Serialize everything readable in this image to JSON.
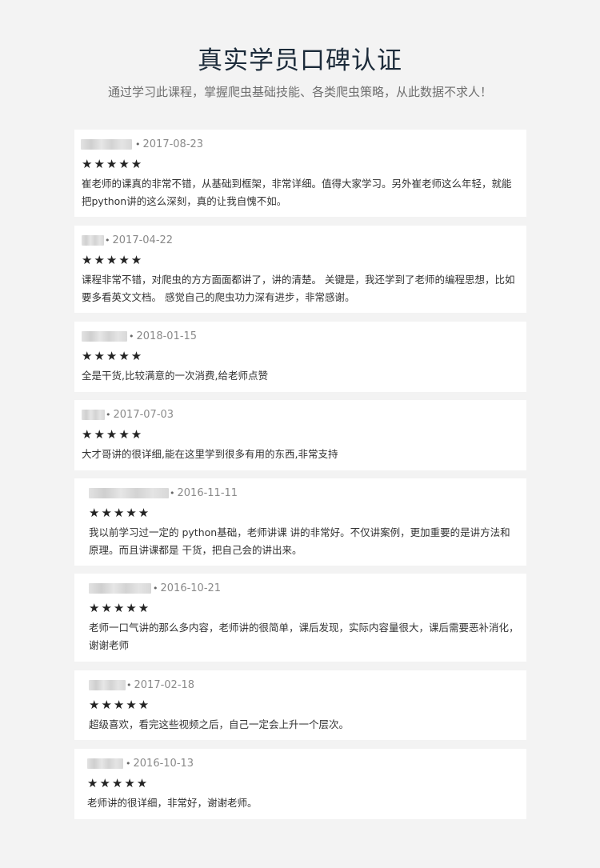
{
  "header": {
    "title": "真实学员口碑认证",
    "subtitle": "通过学习此课程，掌握爬虫基础技能、各类爬虫策略，从此数据不求人！"
  },
  "reviews": [
    {
      "date": "2017-08-23",
      "stars": "★★★★★",
      "text": "崔老师的课真的非常不错，从基础到框架，非常详细。值得大家学习。另外崔老师这么年轻，就能把python讲的这么深刻，真的让我自愧不如。"
    },
    {
      "date": "2017-04-22",
      "stars": "★★★★★",
      "text": "课程非常不错，对爬虫的方方面面都讲了，讲的清楚。 关键是，我还学到了老师的编程思想，比如要多看英文文档。 感觉自己的爬虫功力深有进步，非常感谢。"
    },
    {
      "date": "2018-01-15",
      "stars": "★★★★★",
      "text": "全是干货,比较满意的一次消费,给老师点赞"
    },
    {
      "date": "2017-07-03",
      "stars": "★★★★★",
      "text": "大才哥讲的很详细,能在这里学到很多有用的东西,非常支持"
    },
    {
      "date": "2016-11-11",
      "stars": "★★★★★",
      "text": "我以前学习过一定的 python基础，老师讲课 讲的非常好。不仅讲案例，更加重要的是讲方法和原理。而且讲课都是 干货，把自己会的讲出来。"
    },
    {
      "date": "2016-10-21",
      "stars": "★★★★★",
      "text": "老师一口气讲的那么多内容，老师讲的很简单，课后发现，实际内容量很大，课后需要恶补消化，谢谢老师"
    },
    {
      "date": "2017-02-18",
      "stars": "★★★★★",
      "text": "超级喜欢，看完这些视频之后，自己一定会上升一个层次。"
    },
    {
      "date": "2016-10-13",
      "stars": "★★★★★",
      "text": "老师讲的很详细，非常好，谢谢老师。"
    }
  ]
}
